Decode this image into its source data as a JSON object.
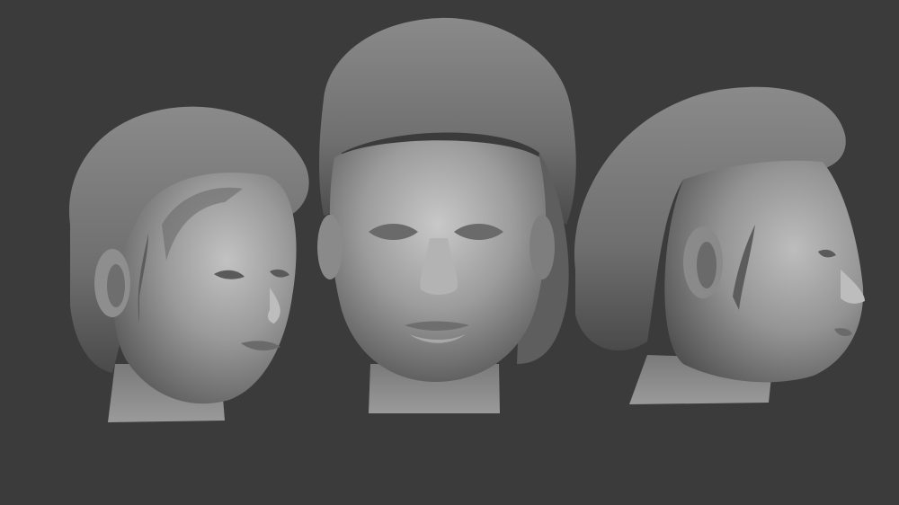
{
  "viewport": {
    "background": "#3b3b3b",
    "material_color": "#8e8e8e"
  },
  "models": [
    {
      "view": "three-quarter-left",
      "icon": "sculpted-head-icon"
    },
    {
      "view": "front",
      "icon": "sculpted-head-icon"
    },
    {
      "view": "profile-right",
      "icon": "sculpted-head-icon"
    }
  ]
}
